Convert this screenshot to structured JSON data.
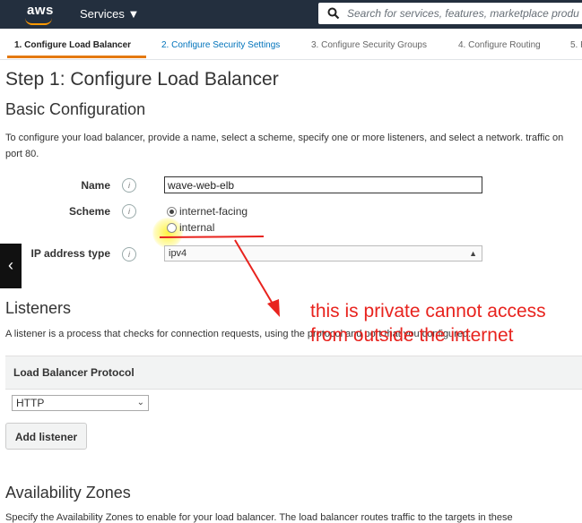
{
  "topbar": {
    "logo": "aws",
    "services_label": "Services ▼",
    "search_placeholder": "Search for services, features, marketplace produ"
  },
  "steps": [
    {
      "label": "1. Configure Load Balancer"
    },
    {
      "label": "2. Configure Security Settings"
    },
    {
      "label": "3. Configure Security Groups"
    },
    {
      "label": "4. Configure Routing"
    },
    {
      "label": "5. R"
    }
  ],
  "page_title": "Step 1: Configure Load Balancer",
  "basic": {
    "title": "Basic Configuration",
    "description": "To configure your load balancer, provide a name, select a scheme, specify one or more listeners, and select a network. traffic on port 80.",
    "name_label": "Name",
    "name_value": "wave-web-elb",
    "scheme_label": "Scheme",
    "scheme_options": [
      "internet-facing",
      "internal"
    ],
    "ip_label": "IP address type",
    "ip_value": "ipv4",
    "info": "i"
  },
  "listeners": {
    "title": "Listeners",
    "description": "A listener is a process that checks for connection requests, using the protocol and port that you configured.",
    "column_header": "Load Balancer Protocol",
    "protocol_value": "HTTP",
    "add_button": "Add listener"
  },
  "availability": {
    "title": "Availability Zones",
    "description": "Specify the Availability Zones to enable for your load balancer. The load balancer routes traffic to the targets in these"
  },
  "annotation": {
    "line1": "this is private cannot access",
    "line2": "from outside the internet",
    "color": "#e8231e"
  },
  "nav": {
    "back_icon": "‹"
  }
}
